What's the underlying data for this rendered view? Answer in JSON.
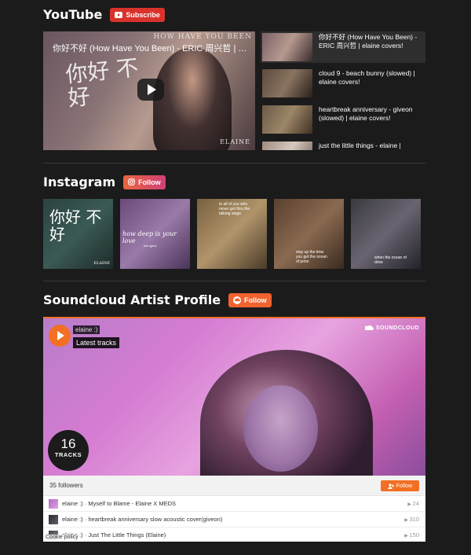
{
  "youtube": {
    "title": "YouTube",
    "subscribe_label": "Subscribe",
    "main_video": {
      "title": "你好不好 (How Have You Been) - ERIC 周兴哲 | elaine covers!",
      "overlay_title": "HOW HAVE YOU BEEN",
      "overlay_calligraphy": "你好 不好",
      "brand": "ELAINE"
    },
    "playlist": [
      {
        "title": "你好不好 (How Have You Been) - ERIC 周兴哲 | elaine covers!"
      },
      {
        "title": "cloud 9 - beach bunny (slowed) | elaine covers!"
      },
      {
        "title": "heartbreak anniversary - giveon (slowed) | elaine covers!"
      },
      {
        "title": "just the little things - elaine |"
      }
    ]
  },
  "instagram": {
    "title": "Instagram",
    "follow_label": "Follow",
    "posts": [
      {
        "caption": "你好 不好",
        "sub": "ELAINE"
      },
      {
        "caption": "how deep is your love",
        "sub": "bee gees"
      },
      {
        "caption": "to all of you who never got thru the talking stage"
      },
      {
        "caption": "stay up the time you get the ocean of jomo"
      },
      {
        "caption": "when the ocean of drive"
      }
    ]
  },
  "soundcloud": {
    "title": "Soundcloud Artist Profile",
    "follow_label": "Follow",
    "widget": {
      "username": "elaine :)",
      "subtitle": "Latest tracks",
      "logo": "SOUNDCLOUD",
      "track_count": "16",
      "track_label": "TRACKS",
      "followers": "35 followers",
      "follow_label": "Follow",
      "tracks": [
        {
          "artist": "elaine :)",
          "title": "Myself to Blame - Elaine X MEDS",
          "plays": "24"
        },
        {
          "artist": "elaine :)",
          "title": "heartbreak anniversary slow acoustic cover(giveon)",
          "plays": "310"
        },
        {
          "artist": "elaine :)",
          "title": "Just The Little Things (Elaine)",
          "plays": "150"
        }
      ],
      "cookie_policy": "Cookie policy"
    }
  },
  "colors": {
    "background": "#1b1b1b",
    "youtube_red": "#d9322a",
    "soundcloud_orange": "#f26f23"
  }
}
